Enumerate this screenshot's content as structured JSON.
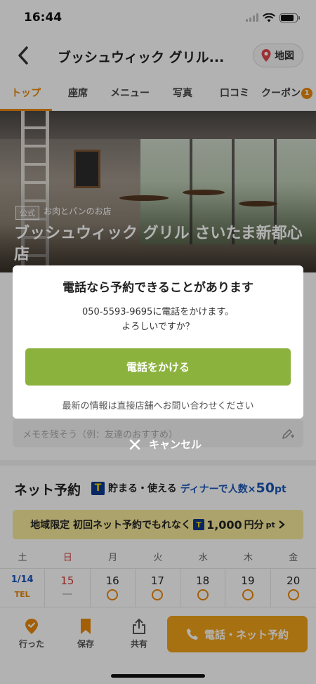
{
  "status_bar": {
    "time": "16:44"
  },
  "header": {
    "title": "ブッシュウィック グリル...",
    "map_label": "地図"
  },
  "tabs": [
    {
      "label": "トップ"
    },
    {
      "label": "座席"
    },
    {
      "label": "メニュー"
    },
    {
      "label": "写真"
    },
    {
      "label": "口コミ"
    },
    {
      "label": "クーポン",
      "badge": "1"
    }
  ],
  "hero": {
    "official_badge": "公式",
    "genre": "お肉とパンのお店",
    "name": "ブッシュウィック グリル さいたま新都心店"
  },
  "memo": {
    "placeholder": "メモを残そう（例：友達のおすすめ）"
  },
  "net_reservation": {
    "title": "ネット予約",
    "tpoint_icon": "T",
    "tpoint_text": "貯まる・使える",
    "tpoint_dinner": "ディナーで人数×",
    "tpoint_pt_value": "50",
    "tpoint_pt_unit": "pt",
    "promo_text": "地域限定 初回ネット予約でもれなく",
    "promo_value": "1,000",
    "promo_unit": "円分",
    "promo_pt": "pt"
  },
  "calendar": {
    "weekdays": [
      "土",
      "日",
      "月",
      "火",
      "水",
      "木",
      "金"
    ],
    "first_date": "1/14",
    "first_label": "TEL",
    "dates": [
      "15",
      "16",
      "17",
      "18",
      "19",
      "20"
    ],
    "date_15_status": "—"
  },
  "bottom_bar": {
    "went_label": "行った",
    "save_label": "保存",
    "share_label": "共有",
    "reserve_label": "電話・ネット予約"
  },
  "dialog": {
    "title": "電話なら予約できることがあります",
    "message_line1": "050-5593-9695に電話をかけます。",
    "message_line2": "よろしいですか？",
    "call_button": "電話をかける",
    "note": "最新の情報は直接店舗へお問い合わせください",
    "cancel": "キャンセル"
  },
  "colors": {
    "accent": "#e8890b",
    "call_green": "#8cb23e",
    "reserve_orange": "#f0a21a",
    "link_blue": "#1a56b8",
    "sunday_red": "#d03a3a"
  }
}
